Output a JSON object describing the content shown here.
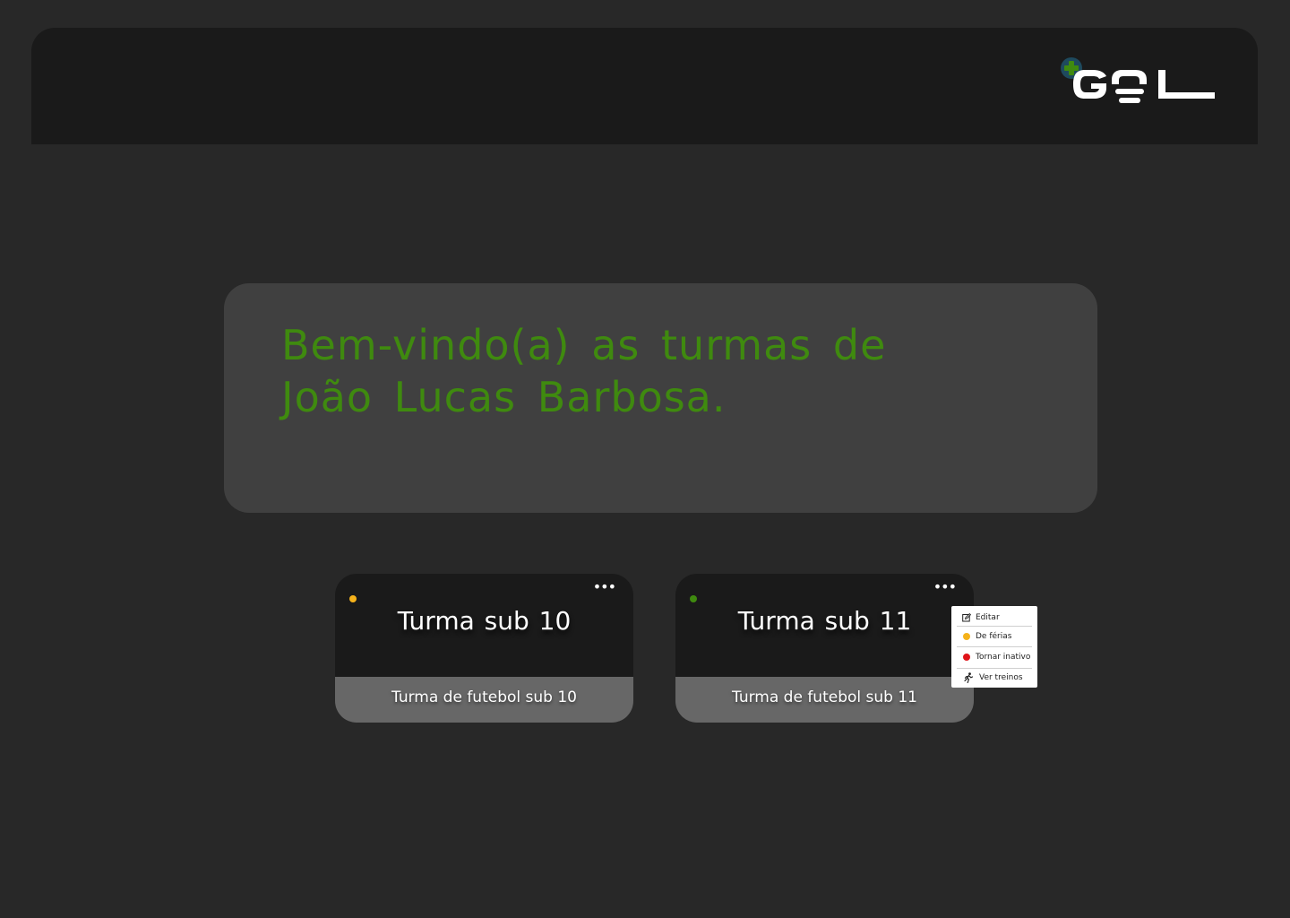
{
  "header": {
    "logo_text": "GOL",
    "logo_plus": "+"
  },
  "welcome": {
    "title": "Bem-vindo(a) as turmas de João Lucas Barbosa."
  },
  "classes": [
    {
      "title": "Turma sub 10",
      "description": "Turma de futebol sub 10",
      "status": "vacation",
      "status_color": "#f5b21b",
      "menu_icon": "more-horizontal-icon"
    },
    {
      "title": "Turma sub 11",
      "description": "Turma de futebol sub 11",
      "status": "active",
      "status_color": "#3f8a0f",
      "menu_icon": "more-horizontal-icon"
    }
  ],
  "context_menu": {
    "items": [
      {
        "label": "Editar",
        "icon": "edit-icon"
      },
      {
        "label": "De férias",
        "icon": "yellow-dot-icon",
        "color": "#f5b21b"
      },
      {
        "label": "Tornar inativo",
        "icon": "red-dot-icon",
        "color": "#e0141a"
      },
      {
        "label": "Ver treinos",
        "icon": "running-person-icon"
      }
    ]
  },
  "colors": {
    "background": "#282828",
    "header": "#1a1a1a",
    "panel": "#404040",
    "accent_green": "#3f8a0f",
    "card_footer": "#676767"
  }
}
